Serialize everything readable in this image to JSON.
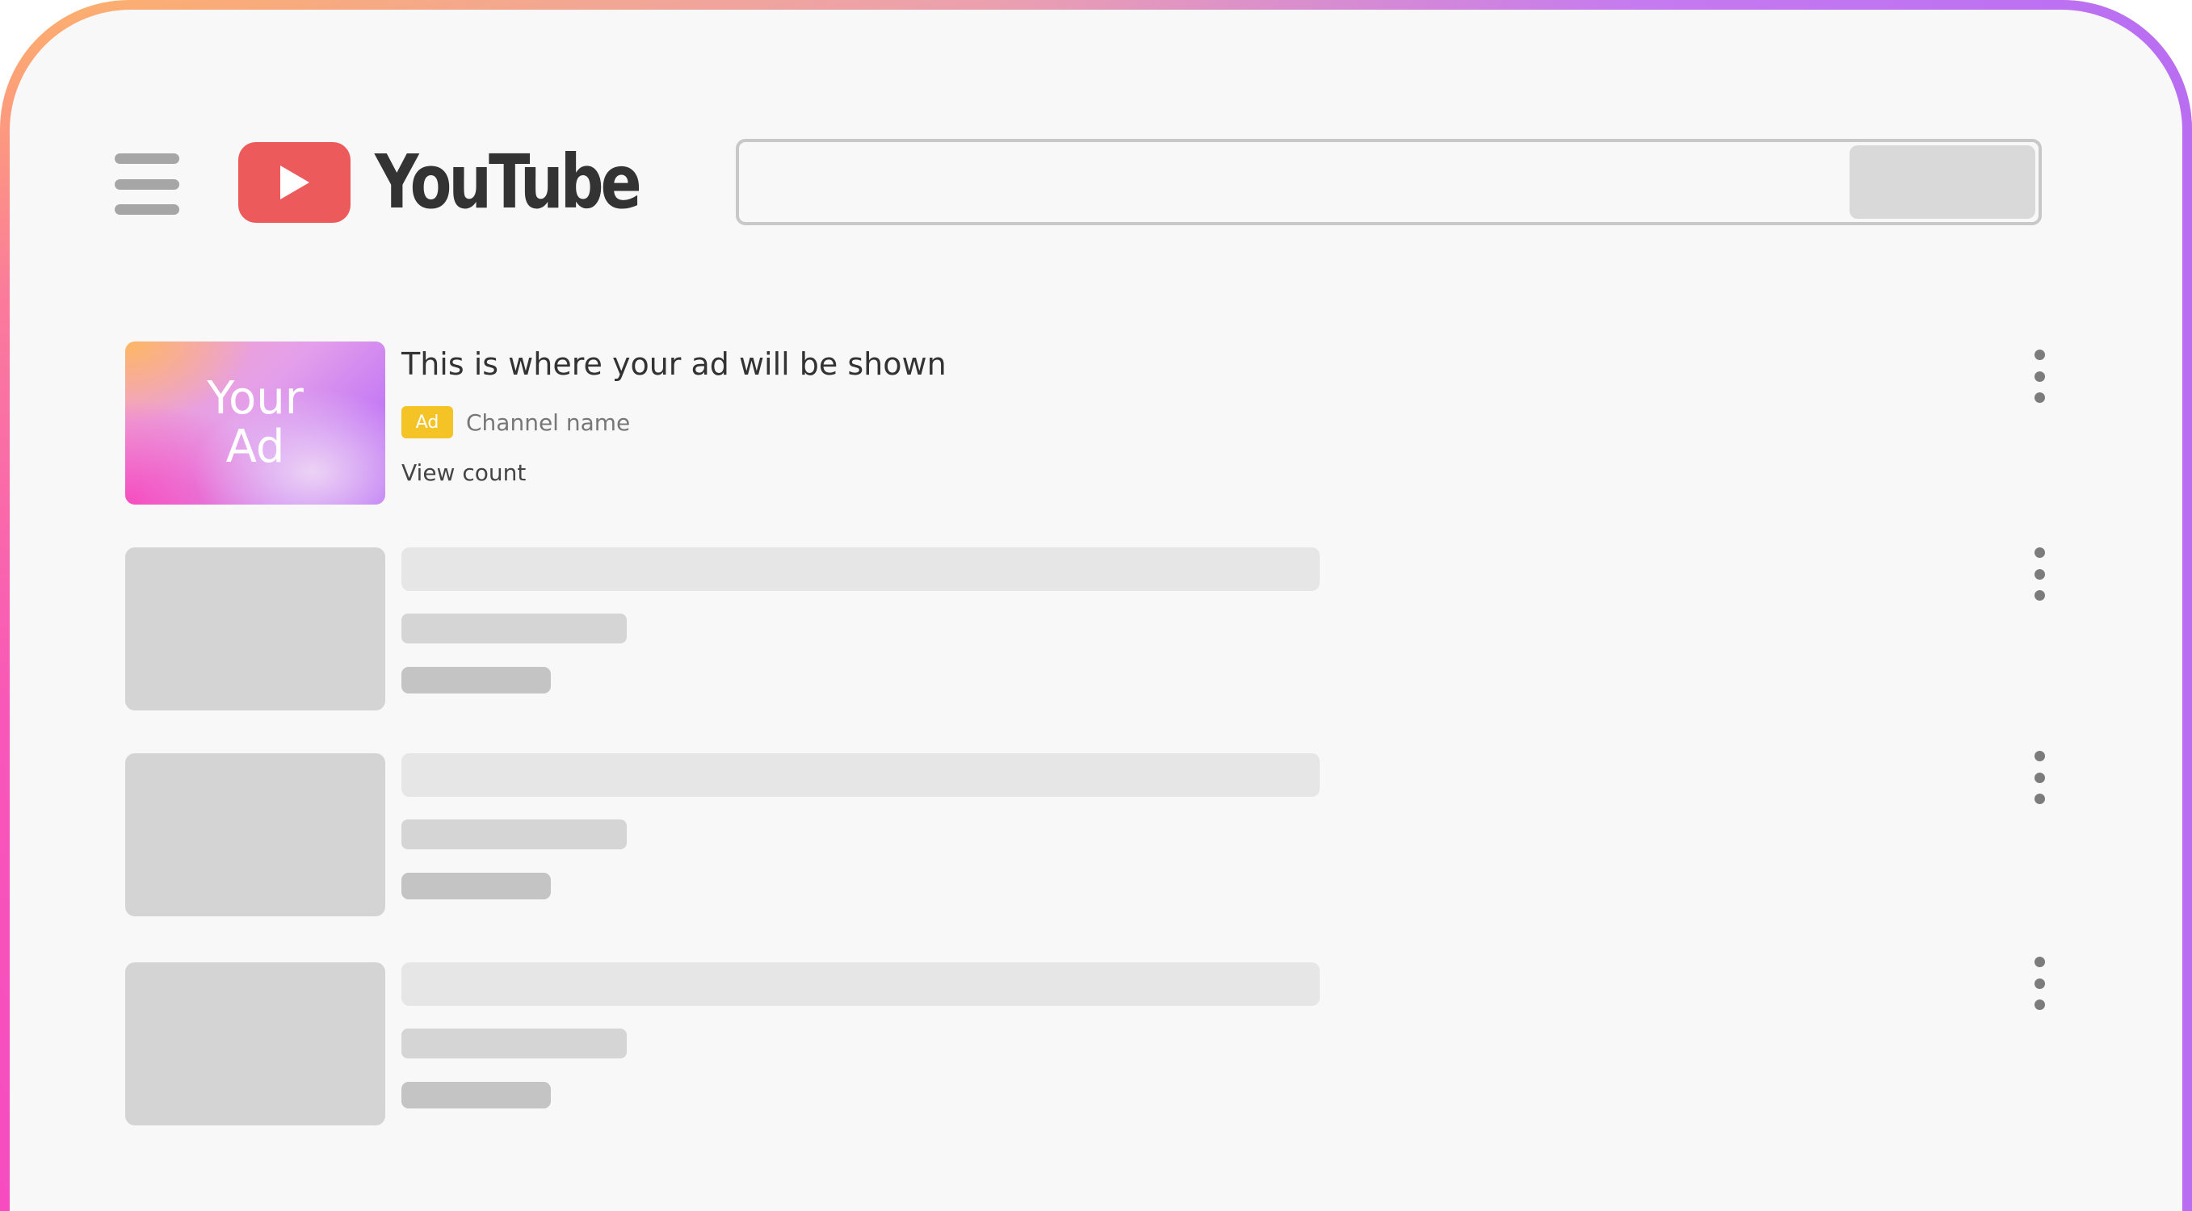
{
  "header": {
    "logo_text": "YouTube",
    "search": {
      "value": "",
      "placeholder": ""
    }
  },
  "colors": {
    "logo_red": "#ec5a5b",
    "ad_badge": "#f4c326",
    "skeleton": "#d4d4d4"
  },
  "ad_item": {
    "thumbnail_text": "Your Ad",
    "title": "This is where your ad will be shown",
    "badge": "Ad",
    "channel": "Channel name",
    "views": "View count"
  },
  "placeholder_items_count_note": "",
  "icons": [
    "menu-icon",
    "play-icon",
    "more-vert-icon"
  ]
}
